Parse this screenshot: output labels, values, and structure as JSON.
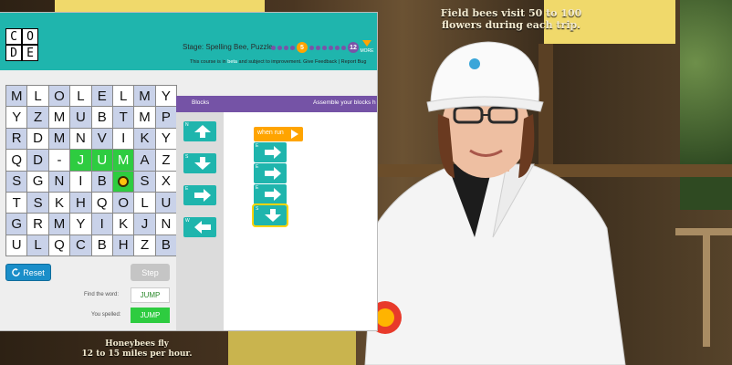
{
  "header": {
    "logo_letters": [
      "C",
      "O",
      "D",
      "E"
    ],
    "stage_label": "Stage: Spelling Bee, Puzzle",
    "current_puzzle": "5",
    "total_puzzles": "12",
    "more_label": "MORE",
    "beta_notice_pre": "This course is in ",
    "beta_notice_word": "beta",
    "beta_notice_post": " and subject to improvement. Give Feedback | Report Bug"
  },
  "grid": {
    "rows": [
      [
        "M",
        "L",
        "O",
        "L",
        "E",
        "L",
        "M",
        "Y"
      ],
      [
        "Y",
        "Z",
        "M",
        "U",
        "B",
        "T",
        "M",
        "P"
      ],
      [
        "R",
        "D",
        "M",
        "N",
        "V",
        "I",
        "K",
        "Y"
      ],
      [
        "Q",
        "D",
        "-",
        "J",
        "U",
        "M",
        "A",
        "Z"
      ],
      [
        "S",
        "G",
        "N",
        "I",
        "B",
        "",
        "S",
        "X"
      ],
      [
        "T",
        "S",
        "K",
        "H",
        "Q",
        "O",
        "L",
        "U"
      ],
      [
        "G",
        "R",
        "M",
        "Y",
        "I",
        "K",
        "J",
        "N"
      ],
      [
        "U",
        "L",
        "Q",
        "C",
        "B",
        "H",
        "Z",
        "B"
      ]
    ]
  },
  "controls": {
    "reset_label": "Reset",
    "step_label": "Step",
    "find_word_label": "Find the word:",
    "find_word_value": "JUMP",
    "you_spelled_label": "You spelled:",
    "you_spelled_value": "JUMP"
  },
  "blocks": {
    "header_label": "Blocks",
    "instruction_label": "Assemble your blocks h",
    "toolbox": [
      {
        "dir": "N",
        "arrow": "up"
      },
      {
        "dir": "S",
        "arrow": "down"
      },
      {
        "dir": "E",
        "arrow": "right"
      },
      {
        "dir": "W",
        "arrow": "left"
      }
    ],
    "when_run_label": "when run",
    "program": [
      {
        "dir": "E",
        "arrow": "right"
      },
      {
        "dir": "E",
        "arrow": "right"
      },
      {
        "dir": "E",
        "arrow": "right"
      },
      {
        "dir": "S",
        "arrow": "down"
      }
    ]
  },
  "video": {
    "sign_top": "Field bees visit 50 to 100\nflowers during each trip.",
    "sign_bottom": "Honeybees fly\n12 to 15 miles per hour."
  },
  "colors": {
    "header_teal": "#1fb5ad",
    "block_teal": "#1fb5ad",
    "purple": "#7553a6",
    "orange": "#ffa400",
    "match_green": "#2ecc40",
    "reset_blue": "#1a8ec9"
  }
}
